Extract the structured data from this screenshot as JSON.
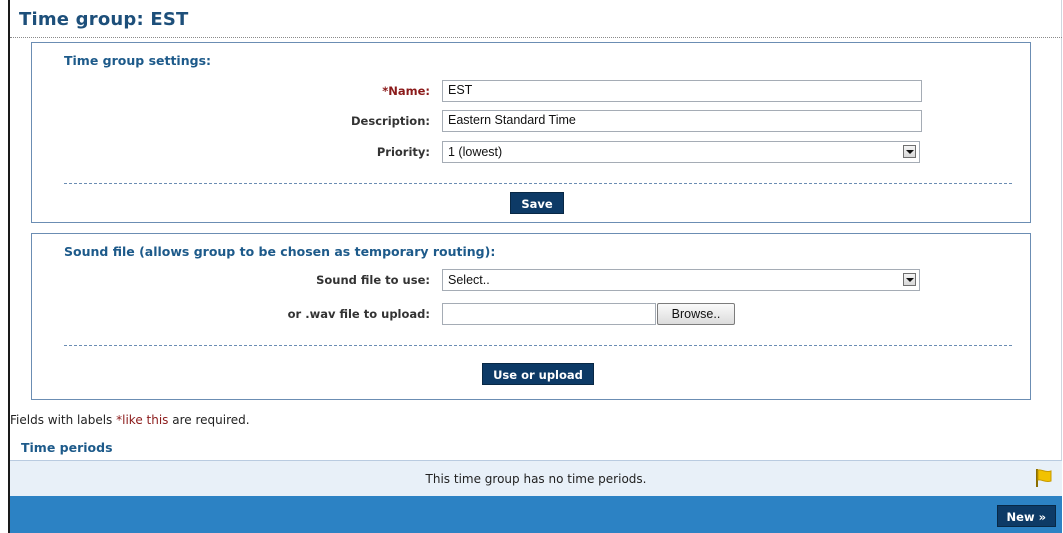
{
  "page": {
    "title": "Time group: EST"
  },
  "settings": {
    "heading": "Time group settings:",
    "name_star": "*",
    "name_label": "Name:",
    "name_value": "EST",
    "description_label": "Description:",
    "description_value": "Eastern Standard Time",
    "priority_label": "Priority:",
    "priority_value": "1 (lowest)",
    "save_label": "Save"
  },
  "sound": {
    "heading": "Sound file (allows group to be chosen as temporary routing):",
    "file_label": "Sound file to use:",
    "file_value": "Select..",
    "upload_label": "or .wav file to upload:",
    "upload_value": "",
    "browse_label": "Browse..",
    "use_upload_label": "Use or upload"
  },
  "note": {
    "prefix": "Fields with labels ",
    "example": "*like this",
    "suffix": " are required."
  },
  "periods": {
    "title": "Time periods",
    "empty_message": "This time group has no time periods.",
    "new_label": "New »"
  },
  "colors": {
    "heading": "#1d5a8a",
    "title": "#1d4f7a",
    "required": "#8b1a1a",
    "button": "#0d3a66",
    "footer": "#2c82c4",
    "empty_bar": "#e8f0f8",
    "panel_border": "#6b8db3"
  },
  "icons": {
    "flag": "flag-icon",
    "select_arrow": "chevron-down-icon"
  }
}
